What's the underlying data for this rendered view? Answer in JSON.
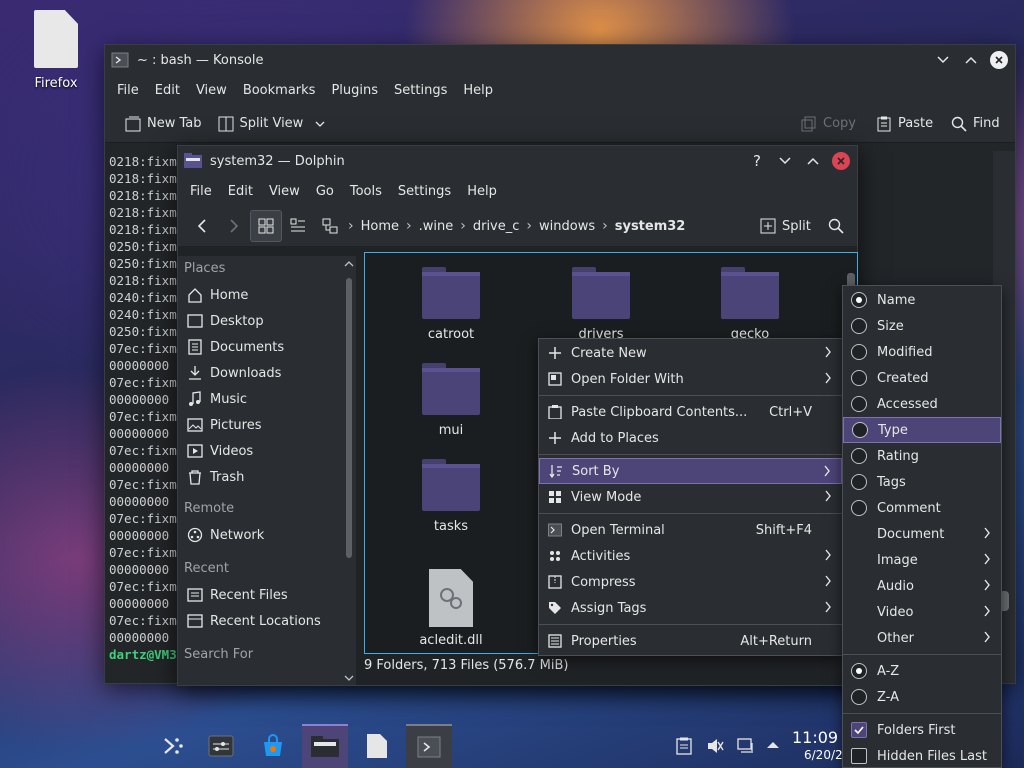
{
  "desktop": {
    "icon_label": "Firefox"
  },
  "konsole": {
    "title": "~ : bash — Konsole",
    "menu": [
      "File",
      "Edit",
      "View",
      "Bookmarks",
      "Plugins",
      "Settings",
      "Help"
    ],
    "toolbar": {
      "new_tab": "New Tab",
      "split_view": "Split View",
      "copy": "Copy",
      "paste": "Paste",
      "find": "Find"
    },
    "terminal_lines": [
      "0218:fixm",
      "0218:fixm",
      "0218:fixm",
      "0218:fixm",
      "0218:fixm",
      "0250:fixm",
      "0250:fixm",
      "0218:fixm",
      "0240:fixm",
      "0240:fixm",
      "0250:fixm",
      "07ec:fixm",
      "00000000",
      "07ec:fixm",
      "00000000",
      "07ec:fixm",
      "00000000",
      "07ec:fixm",
      "00000000",
      "07ec:fixm",
      "00000000",
      "07ec:fixm",
      "00000000",
      "07ec:fixm",
      "00000000",
      "07ec:fixm",
      "00000000",
      "07ec:fixm",
      "00000000"
    ],
    "prompt": "dartz@VM3"
  },
  "dolphin": {
    "title": "system32 — Dolphin",
    "menu": [
      "File",
      "Edit",
      "View",
      "Go",
      "Tools",
      "Settings",
      "Help"
    ],
    "breadcrumb": [
      "Home",
      ".wine",
      "drive_c",
      "windows",
      "system32"
    ],
    "split_label": "Split",
    "places_heading": "Places",
    "places": [
      "Home",
      "Desktop",
      "Documents",
      "Downloads",
      "Music",
      "Pictures",
      "Videos",
      "Trash"
    ],
    "remote_heading": "Remote",
    "remote": [
      "Network"
    ],
    "recent_heading": "Recent",
    "recent": [
      "Recent Files",
      "Recent Locations"
    ],
    "search_heading": "Search For",
    "files": [
      "catroot",
      "drivers",
      "gecko",
      "mui",
      "tasks",
      "acledit.dll"
    ],
    "status": "9 Folders, 713 Files (576.7 MiB)"
  },
  "context_menu": {
    "create_new": "Create New",
    "open_folder_with": "Open Folder With",
    "paste_clipboard": "Paste Clipboard Contents...",
    "paste_shortcut": "Ctrl+V",
    "add_to_places": "Add to Places",
    "sort_by": "Sort By",
    "view_mode": "View Mode",
    "open_terminal": "Open Terminal",
    "open_terminal_shortcut": "Shift+F4",
    "activities": "Activities",
    "compress": "Compress",
    "assign_tags": "Assign Tags",
    "properties": "Properties",
    "properties_shortcut": "Alt+Return"
  },
  "sort_menu": {
    "fields": [
      "Name",
      "Size",
      "Modified",
      "Created",
      "Accessed",
      "Type",
      "Rating",
      "Tags",
      "Comment"
    ],
    "selected_field": "Name",
    "highlighted": "Type",
    "submenus": [
      "Document",
      "Image",
      "Audio",
      "Video",
      "Other"
    ],
    "az": "A-Z",
    "za": "Z-A",
    "folders_first": "Folders First",
    "hidden_last": "Hidden Files Last"
  },
  "taskbar": {
    "time": "11:09",
    "date": "6/20/2"
  },
  "colors": {
    "accent": "#4d4478",
    "highlight_border": "#3daee9",
    "close_red": "#da4453"
  }
}
